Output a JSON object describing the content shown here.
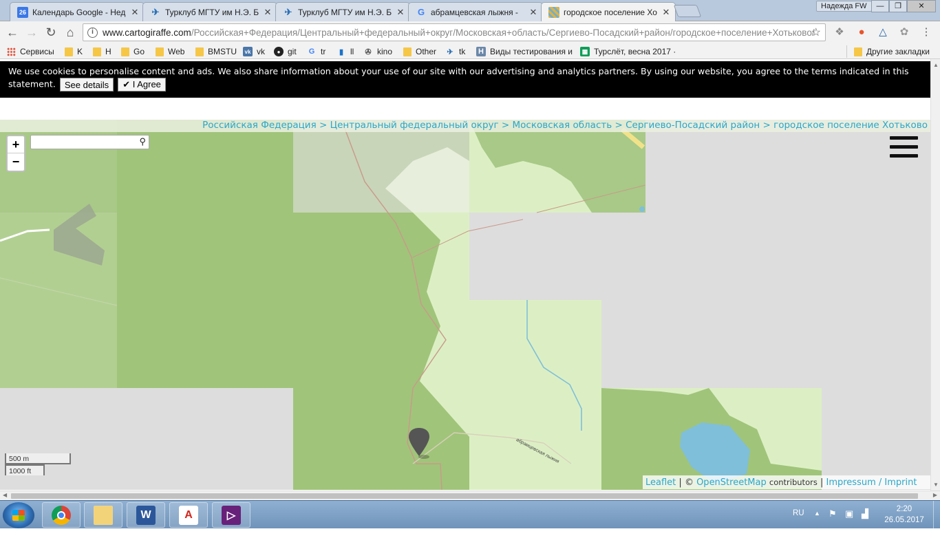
{
  "browser": {
    "tabs": [
      {
        "title": "Календарь Google - Нед",
        "favicon": "calendar-icon",
        "favicon_text": "26",
        "active": false
      },
      {
        "title": "Турклуб МГТУ им Н.Э. Б",
        "favicon": "plane-icon",
        "active": false
      },
      {
        "title": "Турклуб МГТУ им Н.Э. Б",
        "favicon": "plane-icon",
        "active": false
      },
      {
        "title": "абрамцевская лыжня - ",
        "favicon": "google-icon",
        "active": false
      },
      {
        "title": "городское поселение Хо",
        "favicon": "map-icon",
        "active": true
      }
    ],
    "profile_name": "Надежда FW",
    "window_controls": {
      "minimize": "—",
      "maximize": "❐",
      "close": "✕"
    },
    "address": {
      "host": "www.cartogiraffe.com",
      "path": "/Российская+Федерация/Центральный+федеральный+округ/Московская+область/Сергиево-Посадский+район/городское+поселение+Хотьково/"
    },
    "bookmarks": [
      {
        "label": "Сервисы",
        "icon": "apps-grid-icon"
      },
      {
        "label": "K",
        "icon": "folder-icon"
      },
      {
        "label": "H",
        "icon": "folder-icon"
      },
      {
        "label": "Go",
        "icon": "folder-icon"
      },
      {
        "label": "Web",
        "icon": "folder-icon"
      },
      {
        "label": "BMSTU",
        "icon": "folder-icon"
      },
      {
        "label": "vk",
        "icon": "vk-icon"
      },
      {
        "label": "git",
        "icon": "github-icon"
      },
      {
        "label": "tr",
        "icon": "translate-icon"
      },
      {
        "label": "ll",
        "icon": "book-icon"
      },
      {
        "label": "kino",
        "icon": "film-icon"
      },
      {
        "label": "Other",
        "icon": "folder-icon"
      },
      {
        "label": "tk",
        "icon": "plane-icon"
      },
      {
        "label": "Виды тестирования и",
        "icon": "h-icon"
      },
      {
        "label": "Турслёт, весна 2017 ·",
        "icon": "sheets-icon"
      }
    ],
    "other_bookmarks": "Другие закладки"
  },
  "cookie_banner": {
    "text": "We use cookies to personalise content and ads. We also share information about your use of our site with our advertising and analytics partners. By using our website, you agree to the terms indicated in this statement.",
    "details_label": "See details",
    "agree_label": "✔ I Agree"
  },
  "map": {
    "breadcrumb": [
      "Российская Федерация",
      "Центральный федеральный округ",
      "Московская область",
      "Сергиево-Посадский район",
      "городское поселение Хотьково"
    ],
    "breadcrumb_separator": ">",
    "zoom_in": "+",
    "zoom_out": "−",
    "search_placeholder": "",
    "track_label": "абрамцевская лыжня",
    "scale_metric": "500 m",
    "scale_imperial": "1000 ft",
    "attribution": {
      "leaflet": "Leaflet",
      "separator": "|",
      "copyright": "©",
      "osm": "OpenStreetMap",
      "contributors": "contributors",
      "impressum": "Impressum / Imprint"
    },
    "colors": {
      "forest": "#a0c47a",
      "meadow": "#dcefc4",
      "missing_tile": "#dddddd",
      "water": "#7fbfd9",
      "link": "#2aa7c9"
    }
  },
  "taskbar": {
    "apps": [
      {
        "name": "chrome",
        "icon": "chrome-icon"
      },
      {
        "name": "explorer",
        "icon": "folder-icon"
      },
      {
        "name": "word",
        "icon": "word-icon",
        "glyph": "W"
      },
      {
        "name": "acrobat",
        "icon": "pdf-icon",
        "glyph": "A"
      },
      {
        "name": "visual-studio",
        "icon": "visual-studio-icon",
        "glyph": "▷"
      }
    ],
    "language": "RU",
    "time": "2:20",
    "date": "26.05.2017"
  }
}
